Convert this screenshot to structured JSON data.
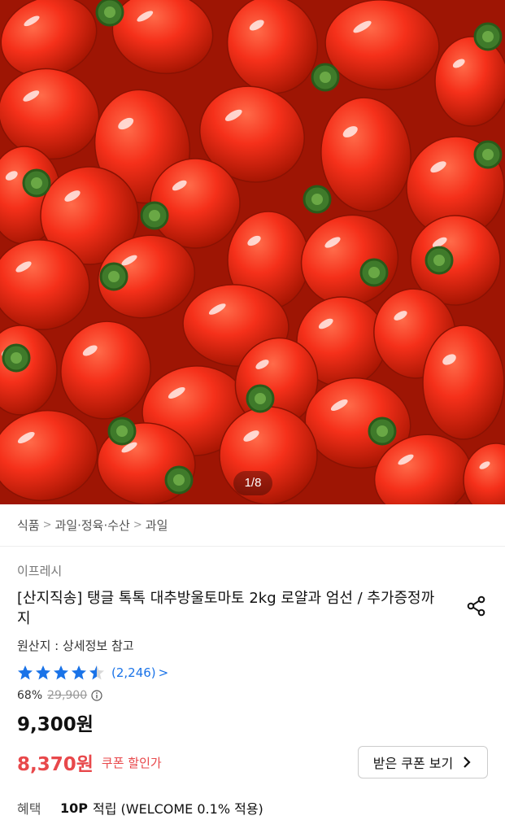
{
  "gallery": {
    "image_alt": "cherry tomatoes",
    "page_indicator": "1/8"
  },
  "breadcrumb": {
    "items": [
      "식품",
      "과일·정육·수산",
      "과일"
    ]
  },
  "product": {
    "seller": "이프레시",
    "title": "[산지직송] 탱글 톡톡 대추방울토마토 2kg 로얄과 엄선 / 추가증정까지",
    "origin": "원산지 : 상세정보 참고",
    "rating_value": 4.5,
    "rating_count": "(2,246)",
    "rating_arrow": ">",
    "discount_rate": "68%",
    "original_price": "29,900",
    "price": "9,300원",
    "coupon_price": "8,370원",
    "coupon_label": "쿠폰 할인가",
    "coupon_button": "받은 쿠폰 보기",
    "benefit_label": "혜택",
    "benefit_points": "10P",
    "benefit_desc": "적립 (WELCOME 0.1% 적용)"
  },
  "colors": {
    "accent_red": "#e8484b",
    "star_blue": "#1a73e8"
  },
  "icons": {
    "share": "share-icon",
    "info": "info-circle-icon",
    "chevron": "chevron-right-icon"
  }
}
